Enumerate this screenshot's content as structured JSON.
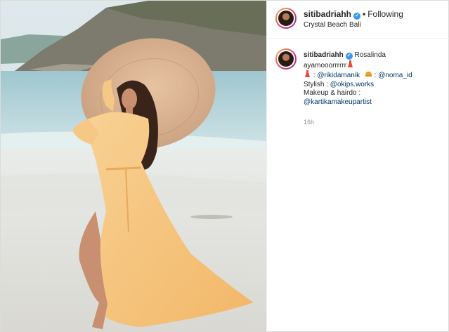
{
  "post": {
    "username": "sitibadriahh",
    "follow_status": "Following",
    "location": "Crystal Beach Bali"
  },
  "caption": {
    "username": "sitibadriahh",
    "name": "Rosalinda",
    "line1": "ayamooorrrrrr",
    "dress_sep": " : ",
    "dress_handle": "@rikidamanik",
    "hair_sep": " : ",
    "hair_handle": "@noma_id",
    "stylish_label": "Stylish : ",
    "stylish_handle": "@okips.works",
    "makeup_label": "Makeup & hairdo :",
    "makeup_handle": "@kartikamakeupartist",
    "timestamp": "16h"
  },
  "icons": {
    "verified": "verified-badge-icon",
    "dress": "dress-emoji-icon",
    "hair": "hair-emoji-icon"
  },
  "colors": {
    "verified": "#3897f0",
    "link": "#00376b",
    "dress": "#f6c27a"
  }
}
